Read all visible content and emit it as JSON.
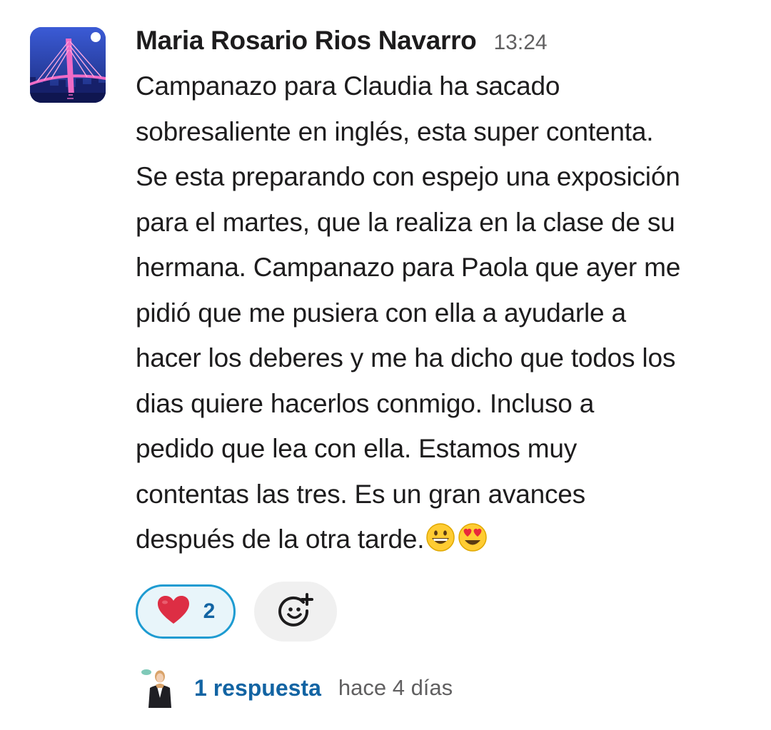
{
  "message": {
    "author": "Maria Rosario Rios Navarro",
    "time": "13:24",
    "lines": [
      "Campanazo para Claudia ha sacado",
      "sobresaliente en inglés, esta super contenta.",
      "Se esta preparando con espejo una exposición",
      "para el martes, que la realiza en la clase de su",
      "hermana. Campanazo para Paola que ayer me",
      "pidió que me pusiera con ella a ayudarle a",
      "hacer los deberes y me ha dicho que todos los",
      "dias quiere hacerlos conmigo. Incluso a",
      "pedido que lea con ella. Estamos muy",
      "contentas las tres. Es un gran avances",
      "después de la otra tarde."
    ],
    "trailing_emojis": [
      "grinning-face",
      "smiling-face-with-heart-eyes"
    ]
  },
  "reactions": [
    {
      "emoji": "red-heart",
      "count": "2"
    }
  ],
  "thread": {
    "replies_label": "1 respuesta",
    "last_reply": "hace 4 días"
  },
  "colors": {
    "link": "#1264a3",
    "reaction_border": "#1d9bd1",
    "reaction_bg": "#e8f5fa",
    "muted_text": "#616061"
  }
}
